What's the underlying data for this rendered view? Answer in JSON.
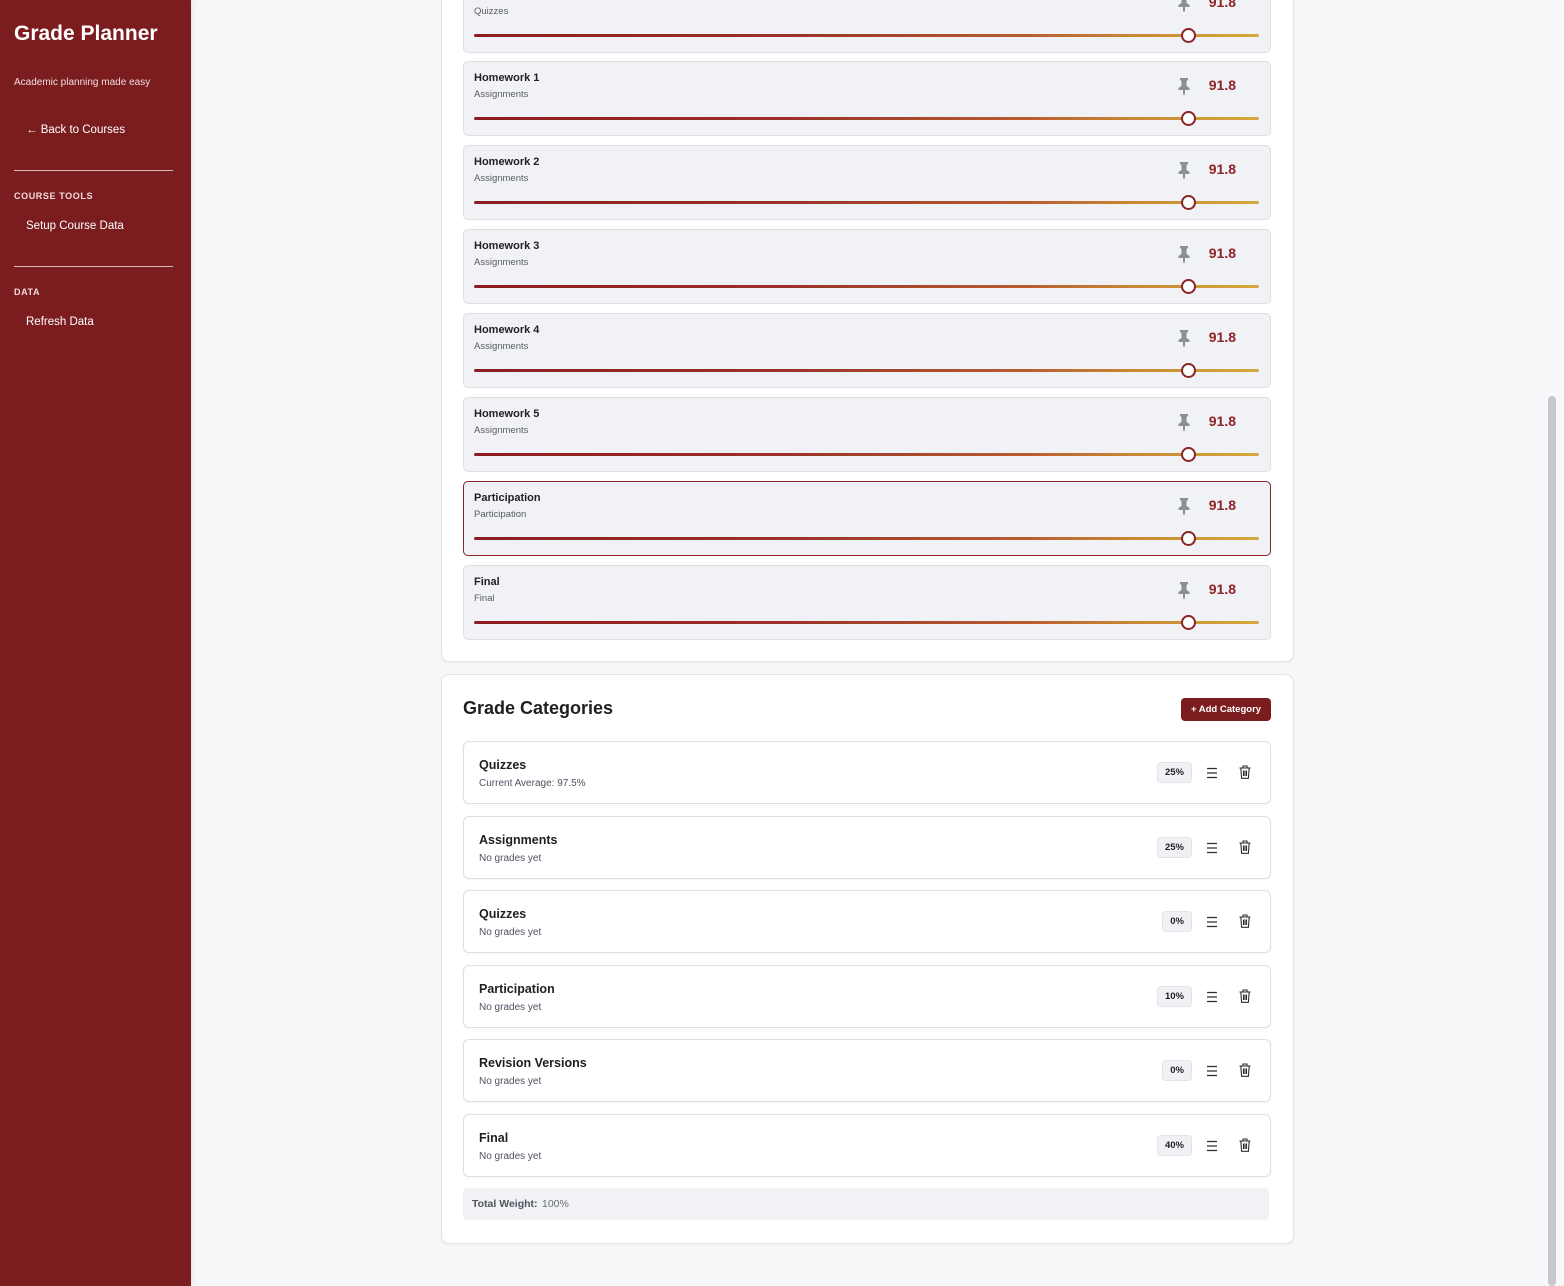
{
  "sidebar": {
    "title": "Grade Planner",
    "subtitle": "Academic planning made easy",
    "back_link": "← Back to Courses",
    "sections": [
      {
        "heading": "COURSE TOOLS",
        "item": "Setup Course Data"
      },
      {
        "heading": "DATA",
        "item": "Refresh Data"
      }
    ]
  },
  "assessments": [
    {
      "name": "",
      "category": "Quizzes",
      "score": "91.8",
      "slider_fraction": 0.91
    },
    {
      "name": "Homework 1",
      "category": "Assignments",
      "score": "91.8",
      "slider_fraction": 0.91
    },
    {
      "name": "Homework 2",
      "category": "Assignments",
      "score": "91.8",
      "slider_fraction": 0.91
    },
    {
      "name": "Homework 3",
      "category": "Assignments",
      "score": "91.8",
      "slider_fraction": 0.91
    },
    {
      "name": "Homework 4",
      "category": "Assignments",
      "score": "91.8",
      "slider_fraction": 0.91
    },
    {
      "name": "Homework 5",
      "category": "Assignments",
      "score": "91.8",
      "slider_fraction": 0.91
    },
    {
      "name": "Participation",
      "category": "Participation",
      "score": "91.8",
      "slider_fraction": 0.91,
      "selected": true
    },
    {
      "name": "Final",
      "category": "Final",
      "score": "91.8",
      "slider_fraction": 0.91
    }
  ],
  "categories_section": {
    "title": "Grade Categories",
    "add_button": "+ Add Category",
    "categories": [
      {
        "name": "Quizzes",
        "status": "Current Average: 97.5%",
        "weight": "25%"
      },
      {
        "name": "Assignments",
        "status": "No grades yet",
        "weight": "25%"
      },
      {
        "name": "Quizzes",
        "status": "No grades yet",
        "weight": "0%"
      },
      {
        "name": "Participation",
        "status": "No grades yet",
        "weight": "10%"
      },
      {
        "name": "Revision Versions",
        "status": "No grades yet",
        "weight": "0%"
      },
      {
        "name": "Final",
        "status": "No grades yet",
        "weight": "40%"
      }
    ],
    "total_label": "Total Weight:",
    "total_value": "100%"
  },
  "colors": {
    "brand": "#7b1d1f",
    "accent": "#8c2325",
    "slider_end": "#d2aa3c"
  }
}
